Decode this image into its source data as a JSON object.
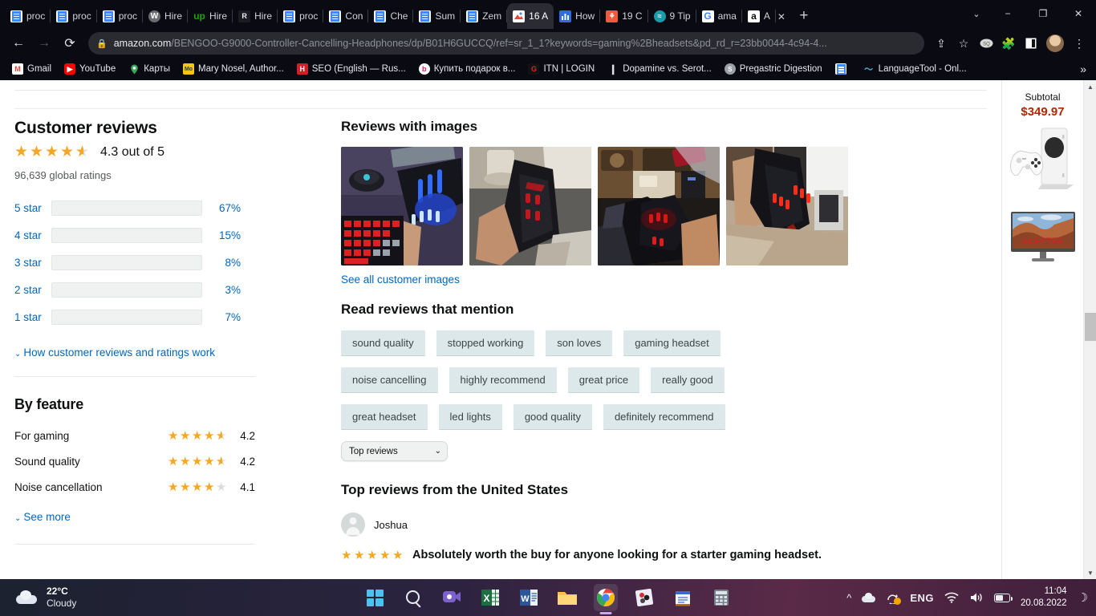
{
  "browser": {
    "tabs": [
      {
        "label": "proc",
        "icon": "doc-icon",
        "active": false
      },
      {
        "label": "proc",
        "icon": "doc-icon",
        "active": false
      },
      {
        "label": "proc",
        "icon": "doc-icon",
        "active": false
      },
      {
        "label": "Hire",
        "icon": "wordpress-icon",
        "active": false
      },
      {
        "label": "Hire",
        "icon": "upwork-icon",
        "active": false
      },
      {
        "label": "Hire",
        "icon": "r-icon",
        "active": false
      },
      {
        "label": "proc",
        "icon": "doc-icon",
        "active": false
      },
      {
        "label": "Con",
        "icon": "doc-icon",
        "active": false
      },
      {
        "label": "Che",
        "icon": "doc-icon",
        "active": false
      },
      {
        "label": "Sum",
        "icon": "doc-icon",
        "active": false
      },
      {
        "label": "Zem",
        "icon": "doc-icon",
        "active": false
      },
      {
        "label": "16 A",
        "icon": "image-icon",
        "active": true
      },
      {
        "label": "How",
        "icon": "chart-icon",
        "active": false
      },
      {
        "label": "19 C",
        "icon": "orange-icon",
        "active": false
      },
      {
        "label": "9 Tip",
        "icon": "teal-icon",
        "active": false
      },
      {
        "label": "ama",
        "icon": "google-icon",
        "active": false
      },
      {
        "label": "A",
        "icon": "amazon-icon",
        "active": false
      }
    ],
    "new_tab_label": "+",
    "window_controls": {
      "chevron": "⌄",
      "minimize": "−",
      "maximize": "❐",
      "close": "✕"
    },
    "nav": {
      "back": "←",
      "forward": "→",
      "reload": "⟳"
    },
    "omnibox": {
      "lock_icon": "lock-icon",
      "url_domain": "amazon.com",
      "url_path": "/BENGOO-G9000-Controller-Cancelling-Headphones/dp/B01H6GUCCQ/ref=sr_1_1?keywords=gaming%2Bheadsets&pd_rd_r=23bb0044-4c94-4..."
    },
    "toolbar_icons": [
      "share-icon",
      "bookmark-star-icon",
      "seo-extension-icon",
      "puzzle-extension-icon",
      "sidepanel-icon",
      "profile-avatar",
      "menu-kebab-icon"
    ],
    "bookmarks": [
      {
        "label": "Gmail",
        "icon": "gmail-icon"
      },
      {
        "label": "YouTube",
        "icon": "youtube-icon"
      },
      {
        "label": "Карты",
        "icon": "maps-icon"
      },
      {
        "label": "Mary Nosel, Author...",
        "icon": "mo-icon"
      },
      {
        "label": "SEO (English — Rus...",
        "icon": "h-icon"
      },
      {
        "label": "Купить подарок в...",
        "icon": "b-icon"
      },
      {
        "label": "ITN | LOGIN",
        "icon": "g-red-icon"
      },
      {
        "label": "Dopamine vs. Serot...",
        "icon": "book-icon"
      },
      {
        "label": "Pregastric Digestion",
        "icon": "globe-icon"
      },
      {
        "label": "",
        "icon": "doc-blue-icon"
      },
      {
        "label": "LanguageTool - Onl...",
        "icon": "languagetool-icon"
      }
    ],
    "bookmarks_overflow": "»"
  },
  "reviews": {
    "heading": "Customer reviews",
    "rating_value": "4.3 out of 5",
    "rating_stars": 4.3,
    "global_ratings": "96,639 global ratings",
    "bars": [
      {
        "label": "5 star",
        "percent": "67%",
        "value": 67
      },
      {
        "label": "4 star",
        "percent": "15%",
        "value": 15
      },
      {
        "label": "3 star",
        "percent": "8%",
        "value": 8
      },
      {
        "label": "2 star",
        "percent": "3%",
        "value": 3
      },
      {
        "label": "1 star",
        "percent": "7%",
        "value": 7
      }
    ],
    "how_link": "How customer reviews and ratings work",
    "by_feature": {
      "heading": "By feature",
      "items": [
        {
          "name": "For gaming",
          "score": "4.2",
          "stars": 4.2
        },
        {
          "name": "Sound quality",
          "score": "4.2",
          "stars": 4.2
        },
        {
          "name": "Noise cancellation",
          "score": "4.1",
          "stars": 4.0
        }
      ],
      "see_more": "See more"
    }
  },
  "images_section": {
    "heading": "Reviews with images",
    "see_all": "See all customer images",
    "thumbs": [
      "review-image-1",
      "review-image-2",
      "review-image-3",
      "review-image-4"
    ]
  },
  "mentions": {
    "heading": "Read reviews that mention",
    "rows": [
      [
        "sound quality",
        "stopped working",
        "son loves",
        "gaming headset"
      ],
      [
        "noise cancelling",
        "highly recommend",
        "great price",
        "really good"
      ],
      [
        "great headset",
        "led lights",
        "good quality",
        "definitely recommend"
      ]
    ]
  },
  "top_reviews": {
    "sort_value": "Top reviews",
    "heading": "Top reviews from the United States",
    "review": {
      "author": "Joshua",
      "stars": 5,
      "title": "Absolutely worth the buy for anyone looking for a starter gaming headset."
    }
  },
  "rail": {
    "subtotal_label": "Subtotal",
    "subtotal_value": "$349.97",
    "products": [
      "xbox-series-s-image",
      "sceptre-monitor-image"
    ],
    "monitor_brand": "SCEPTRE"
  },
  "scrollbar": {
    "up": "▲",
    "down": "▼"
  },
  "taskbar": {
    "weather": {
      "temp": "22°C",
      "desc": "Cloudy"
    },
    "apps": [
      "start-icon",
      "search-icon",
      "teams-icon",
      "excel-icon",
      "word-icon",
      "file-explorer-icon",
      "chrome-icon",
      "photos-icon",
      "notepad-icon",
      "calculator-icon"
    ],
    "tray": {
      "overflow": "^",
      "icons": [
        "onedrive-icon",
        "sync-icon",
        "wifi-icon",
        "volume-icon",
        "battery-icon"
      ],
      "language": "ENG",
      "time": "11:04",
      "date": "20.08.2022",
      "notification": "☽"
    }
  },
  "colors": {
    "amazon_link": "#0066c0",
    "star_orange": "#f5a623",
    "price_red": "#b12704",
    "tag_bg": "#dce8ea"
  }
}
